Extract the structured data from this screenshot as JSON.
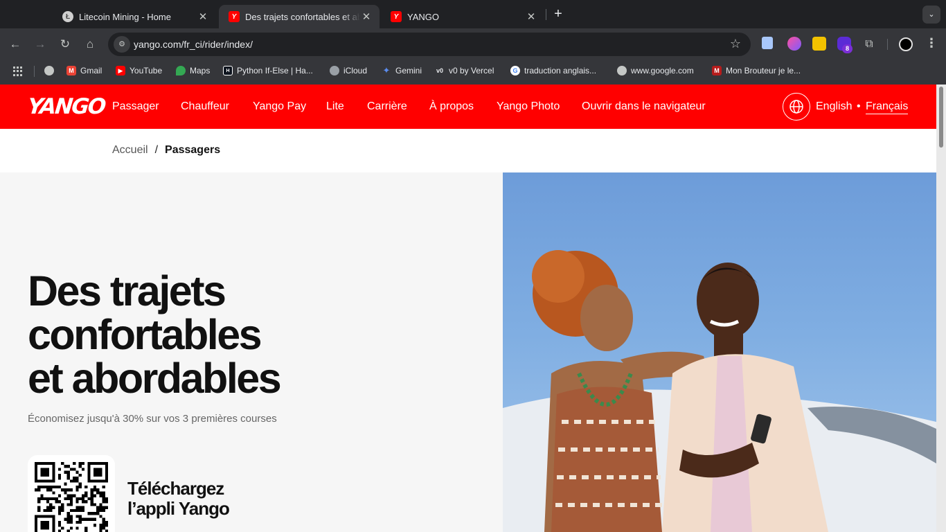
{
  "browser": {
    "tabs": [
      {
        "title": "Litecoin Mining - Home",
        "active": false
      },
      {
        "title": "Des trajets confortables et abordables",
        "active": true
      },
      {
        "title": "YANGO",
        "active": false
      }
    ],
    "url": "yango.com/fr_ci/rider/index/",
    "extension_badge": "8",
    "bookmarks": [
      {
        "label": "Gmail",
        "icon": "gmail-icon"
      },
      {
        "label": "YouTube",
        "icon": "youtube-icon"
      },
      {
        "label": "Maps",
        "icon": "maps-icon"
      },
      {
        "label": "Python If-Else | Ha...",
        "icon": "hackerrank-icon"
      },
      {
        "label": "iCloud",
        "icon": "apple-icon"
      },
      {
        "label": "Gemini",
        "icon": "gemini-icon"
      },
      {
        "label": "v0 by Vercel",
        "icon": "v0-icon"
      },
      {
        "label": "traduction anglais...",
        "icon": "google-icon"
      },
      {
        "label": "www.google.com",
        "icon": "globe-icon"
      },
      {
        "label": "Mon Brouteur je le...",
        "icon": "m-icon"
      }
    ]
  },
  "site": {
    "logo": "YANGO",
    "brand_color": "#ff0000",
    "nav": [
      "Passager",
      "Chauffeur",
      "Yango Pay",
      "Lite",
      "Carrière",
      "À propos",
      "Yango Photo",
      "Ouvrir dans le navigateur"
    ],
    "languages": {
      "english": "English",
      "separator": "•",
      "french": "Français",
      "selected": "Français"
    }
  },
  "breadcrumb": {
    "home": "Accueil",
    "separator": "/",
    "current": "Passagers"
  },
  "hero": {
    "title_lines": [
      "Des trajets",
      "confortables",
      "et abordables"
    ],
    "subtitle": "Économisez jusqu'à 30% sur vos 3 premières courses",
    "download_lines": [
      "Téléchargez",
      "l’appli Yango"
    ],
    "image_description_icon": "hero-photo"
  }
}
